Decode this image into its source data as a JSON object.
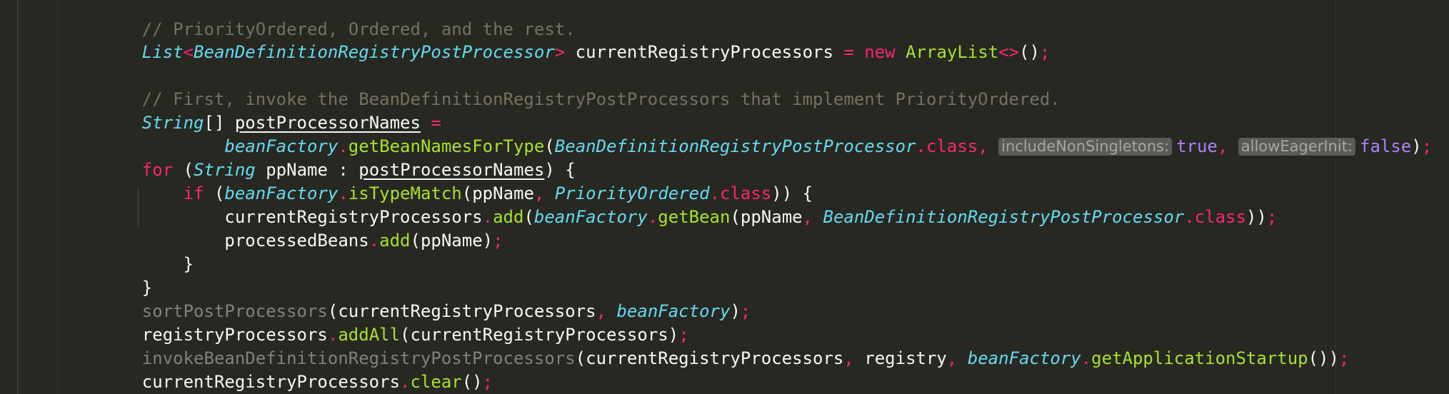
{
  "code": {
    "l1": {
      "comment": "// PriorityOrdered, Ordered, and the rest."
    },
    "l2": {
      "type_list": "List",
      "lt": "<",
      "type_generic": "BeanDefinitionRegistryPostProcessor",
      "gt": ">",
      "var": " currentRegistryProcessors ",
      "eq": "=",
      "space": " ",
      "kw_new": "new",
      "space2": " ",
      "cls": "ArrayList",
      "diamond": "<>",
      "tail_a": "()",
      "semi": ";"
    },
    "l3": {
      "comment": "// First, invoke the BeanDefinitionRegistryPostProcessors that implement PriorityOrdered."
    },
    "l4": {
      "type": "String",
      "brackets": "[] ",
      "var": "postProcessorNames",
      "eq": " ="
    },
    "l5": {
      "indent": "        ",
      "field": "beanFactory",
      "dot": ".",
      "method": "getBeanNamesForType",
      "open": "(",
      "cls": "BeanDefinitionRegistryPostProcessor",
      "dotclass": ".class",
      "comma": ", ",
      "hint1": "includeNonSingletons:",
      "val1": "true",
      "comma2": ", ",
      "hint2": "allowEagerInit:",
      "val2": "false",
      "close": ")",
      "semi": ";"
    },
    "l6": {
      "kw": "for",
      "open": " (",
      "type": "String",
      "var": " ppName : ",
      "iter": "postProcessorNames",
      "close": ") {"
    },
    "l7": {
      "indent": "    ",
      "kw": "if",
      "open": " (",
      "field": "beanFactory",
      "dot": ".",
      "method": "isTypeMatch",
      "args": "(ppName",
      "comma": ", ",
      "cls": "PriorityOrdered",
      "dotclass": ".class",
      "close": ")) {"
    },
    "l8": {
      "indent": "        ",
      "var": "currentRegistryProcessors",
      "dot": ".",
      "method": "add",
      "open": "(",
      "field": "beanFactory",
      "dot2": ".",
      "method2": "getBean",
      "args": "(ppName",
      "comma": ", ",
      "cls": "BeanDefinitionRegistryPostProcessor",
      "dotclass": ".class",
      "close": "))",
      "semi": ";"
    },
    "l9": {
      "indent": "        ",
      "var": "processedBeans",
      "dot": ".",
      "method": "add",
      "args": "(ppName)",
      "semi": ";"
    },
    "l10": {
      "text": "    }"
    },
    "l11": {
      "text": "}"
    },
    "l12": {
      "method": "sortPostProcessors",
      "args": "(currentRegistryProcessors",
      "comma": ", ",
      "field": "beanFactory",
      "close": ")",
      "semi": ";"
    },
    "l13": {
      "var": "registryProcessors",
      "dot": ".",
      "method": "addAll",
      "args": "(currentRegistryProcessors)",
      "semi": ";"
    },
    "l14": {
      "method": "invokeBeanDefinitionRegistryPostProcessors",
      "args": "(currentRegistryProcessors",
      "comma": ", ",
      "arg2": "registry",
      "comma2": ", ",
      "field": "beanFactory",
      "dot": ".",
      "method2": "getApplicationStartup",
      "close": "())",
      "semi": ";"
    },
    "l15": {
      "var": "currentRegistryProcessors",
      "dot": ".",
      "method": "clear",
      "args": "()",
      "semi": ";"
    }
  },
  "colors": {
    "background": "#272822",
    "comment": "#75715e",
    "keyword": "#f92672",
    "type": "#66d9ef",
    "method": "#a6e22e",
    "literal": "#ae81ff",
    "text": "#f8f8f2"
  }
}
